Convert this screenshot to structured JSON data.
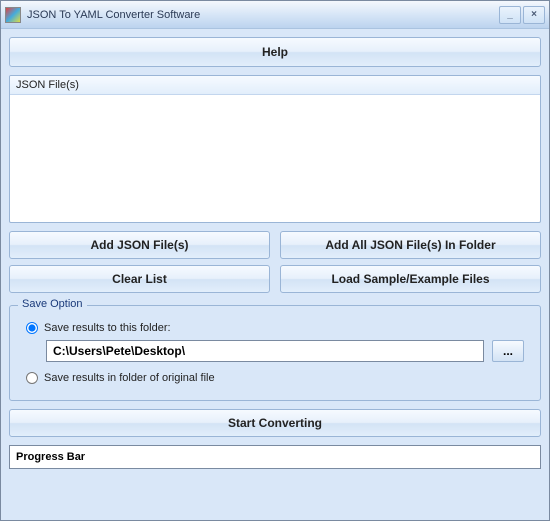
{
  "titlebar": {
    "title": "JSON To YAML Converter Software",
    "minimize": "_",
    "close": "×"
  },
  "help_button": "Help",
  "file_list_header": "JSON File(s)",
  "buttons": {
    "add_files": "Add JSON File(s)",
    "add_folder": "Add All JSON File(s) In Folder",
    "clear_list": "Clear List",
    "load_sample": "Load Sample/Example Files"
  },
  "save_option": {
    "group_title": "Save Option",
    "radio_folder_label": "Save results to this folder:",
    "path_value": "C:\\Users\\Pete\\Desktop\\",
    "browse_label": "...",
    "radio_original_label": "Save results in folder of original file",
    "selected": "folder"
  },
  "start_button": "Start Converting",
  "progress_label": "Progress Bar"
}
